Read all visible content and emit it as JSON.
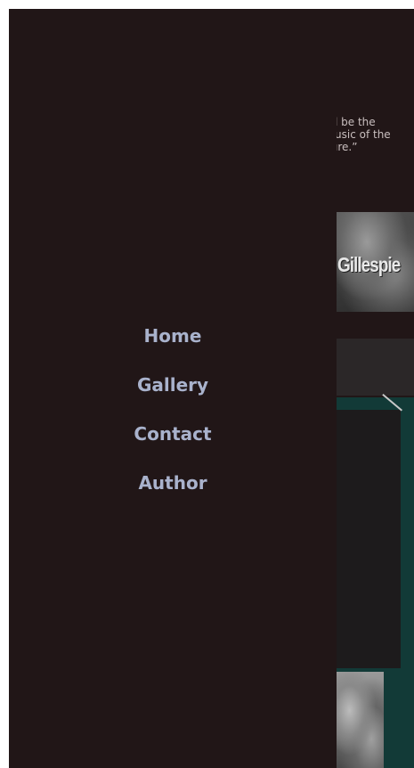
{
  "background": {
    "quote_lines": [
      "l be the",
      "usic of the",
      "ıre.”"
    ],
    "photo_caption": "Gillespie"
  },
  "drawer": {
    "nav_items": [
      {
        "label": "Home"
      },
      {
        "label": "Gallery"
      },
      {
        "label": "Contact"
      },
      {
        "label": "Author"
      }
    ]
  },
  "colors": {
    "page_bg": "#211617",
    "nav_text": "#a9b2cc",
    "teal_section": "#123a37"
  }
}
